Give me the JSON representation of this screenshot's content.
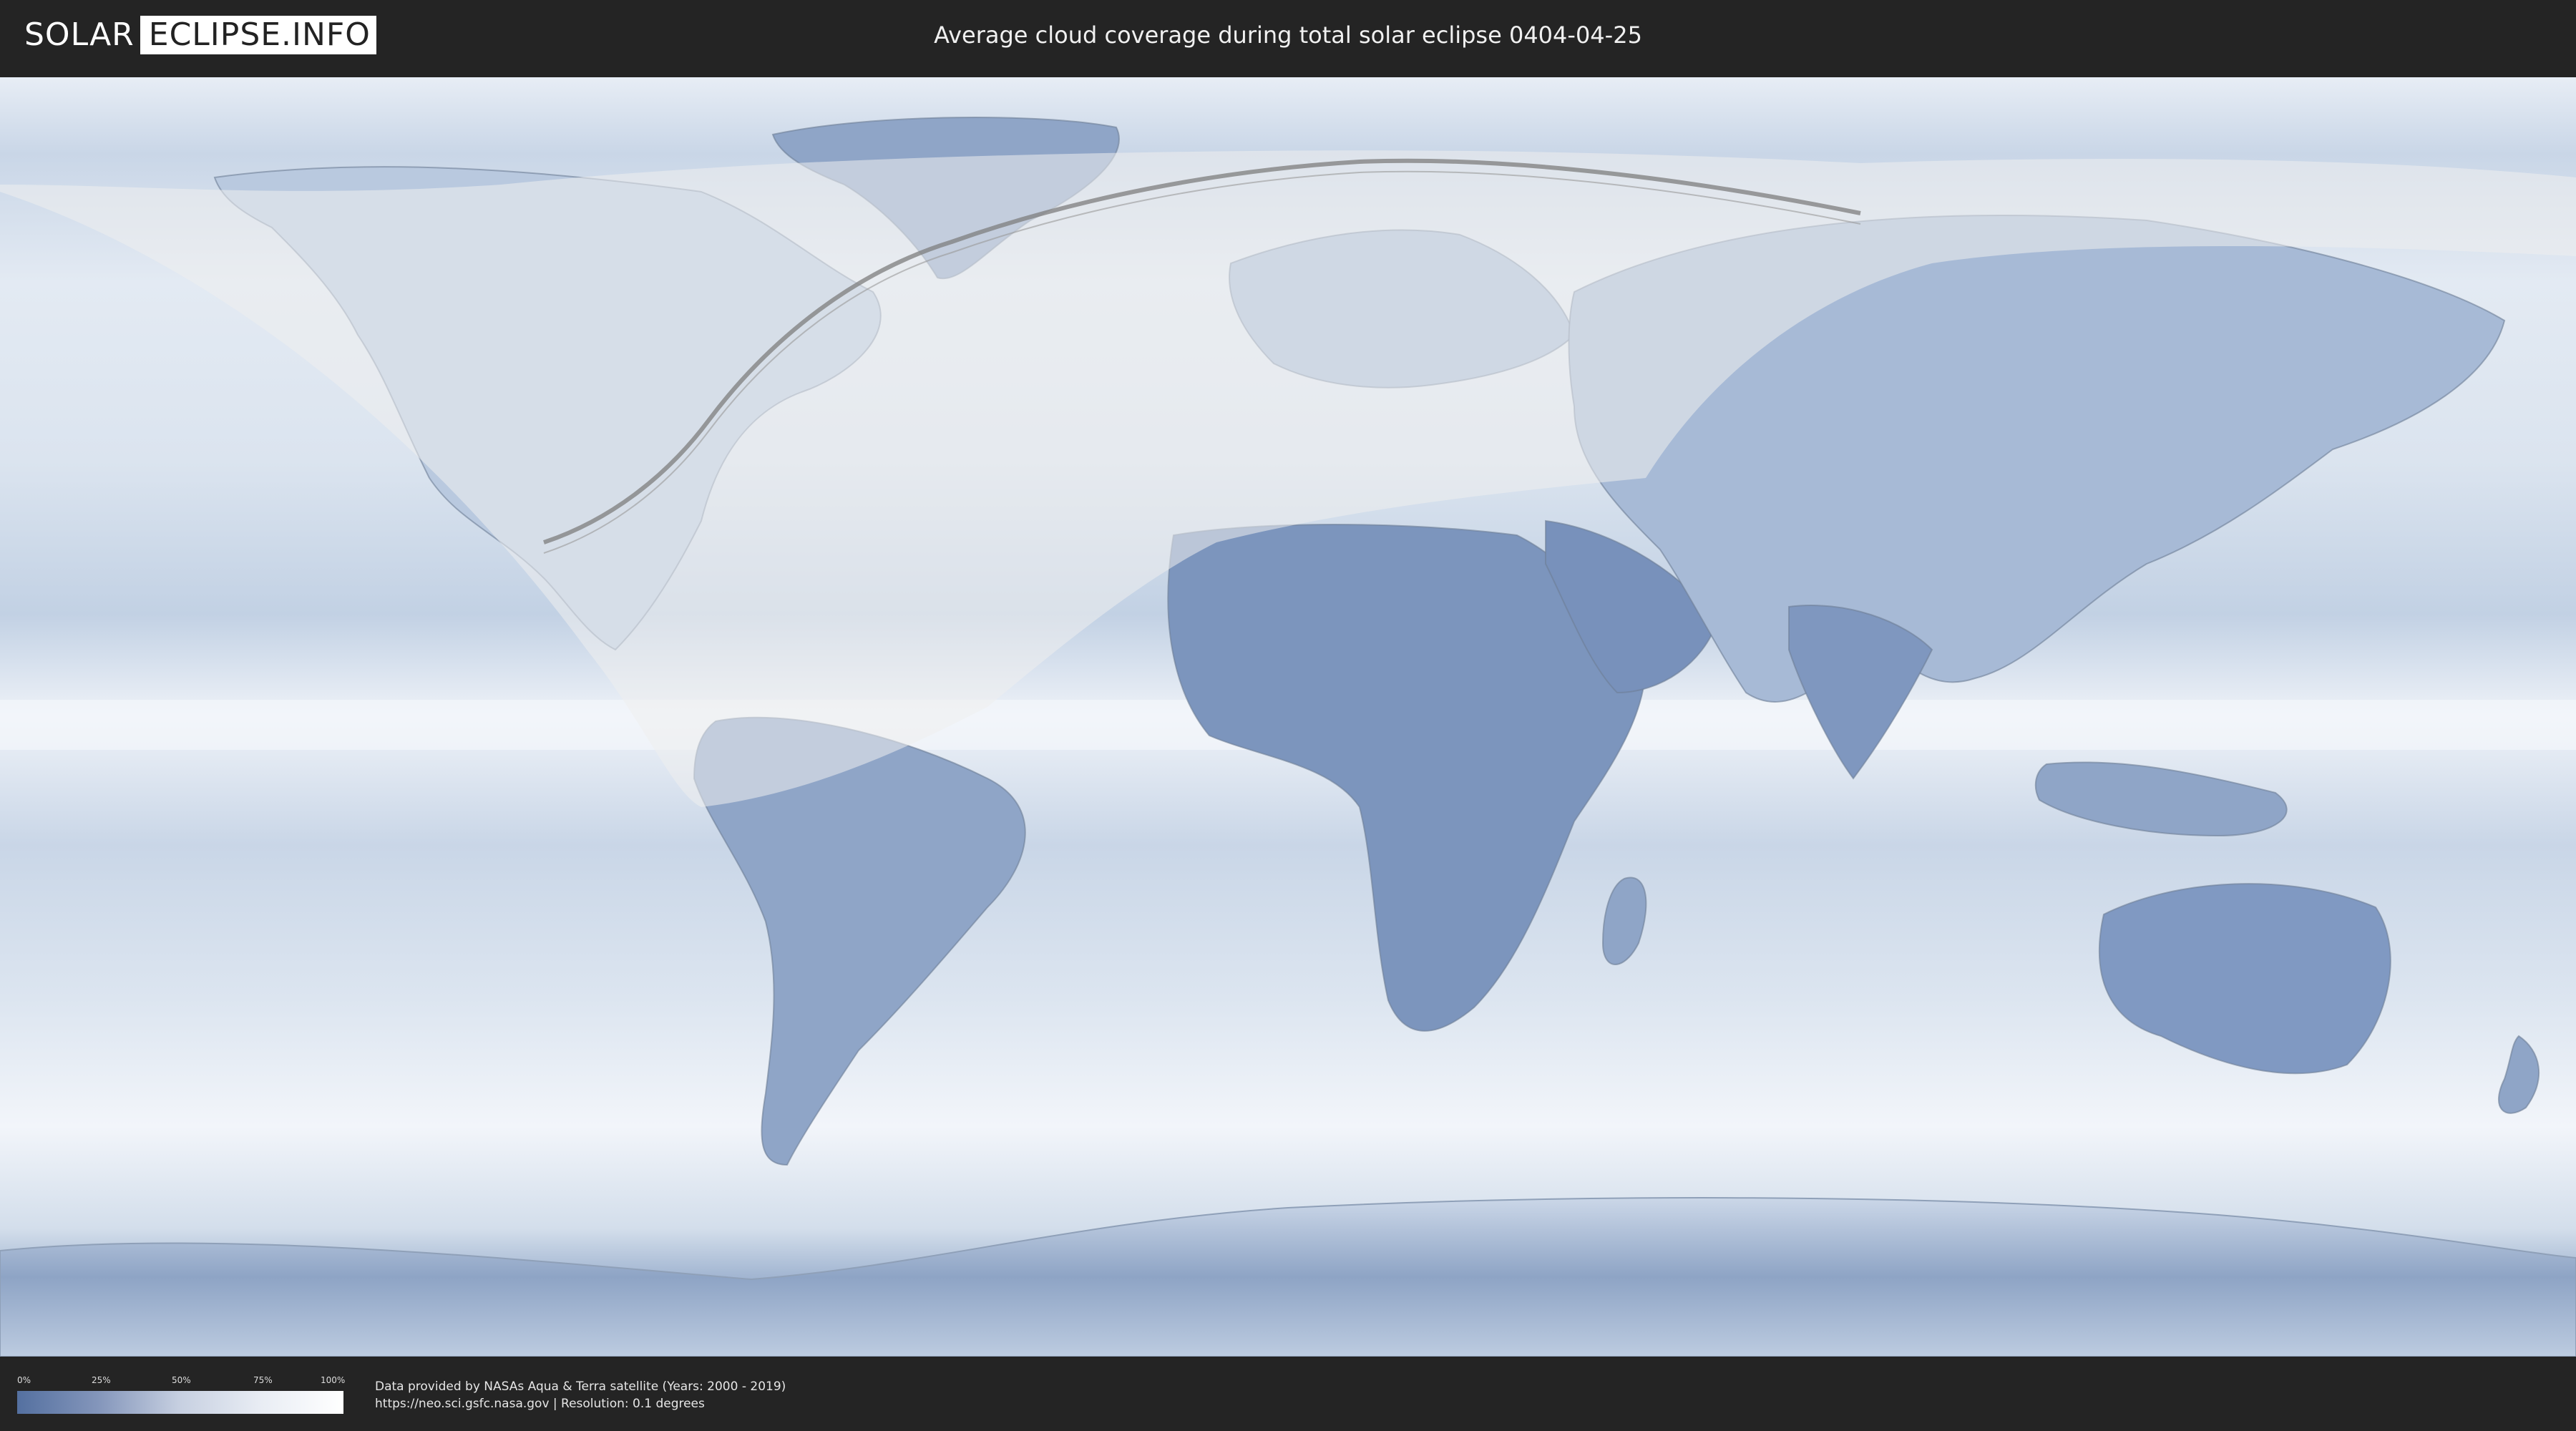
{
  "header": {
    "logo_left": "SOLAR",
    "logo_right": "ECLIPSE.INFO",
    "title": "Average cloud coverage during total solar eclipse 0404-04-25"
  },
  "legend": {
    "ticks": [
      "0%",
      "25%",
      "50%",
      "75%",
      "100%"
    ],
    "gradient": [
      "#5470a0",
      "#8496bb",
      "#c7d0e1",
      "#e9edf4",
      "#ffffff"
    ]
  },
  "credits": {
    "line1": "Data provided by NASAs Aqua & Terra satellite (Years: 2000 - 2019)",
    "line2": "https://neo.sci.gsfc.nasa.gov | Resolution: 0.1 degrees"
  },
  "map": {
    "projection": "equirectangular",
    "layer": "average cloud coverage",
    "colors": {
      "clear": "#5470a0",
      "cloud": "#ffffff",
      "visibility_overlay": "#e8e8e8",
      "totality_path": "#888888"
    }
  }
}
